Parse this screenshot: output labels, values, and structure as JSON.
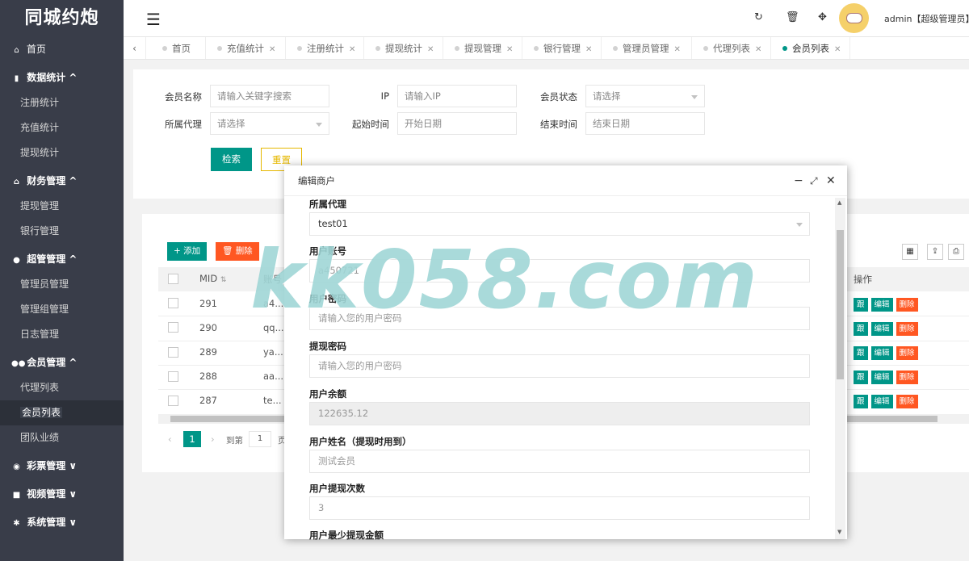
{
  "app": {
    "title": "同城约炮"
  },
  "sidebar": {
    "home": "首页",
    "groups": [
      {
        "label": "数据统计 ^",
        "icon": "bar-chart-icon",
        "items": [
          "注册统计",
          "充值统计",
          "提现统计"
        ]
      },
      {
        "label": "财务管理 ^",
        "icon": "bank-icon",
        "items": [
          "提现管理",
          "银行管理"
        ]
      },
      {
        "label": "超管管理 ^",
        "icon": "user-icon",
        "items": [
          "管理员管理",
          "管理组管理",
          "日志管理"
        ]
      },
      {
        "label": "会员管理 ^",
        "icon": "users-icon",
        "items": [
          "代理列表",
          "会员列表",
          "团队业绩"
        ]
      }
    ],
    "collapsed": [
      "彩票管理 ∨",
      "视频管理 ∨",
      "系统管理 ∨"
    ],
    "active_item": "会员列表"
  },
  "header": {
    "user": "admin【超级管理员】"
  },
  "tabs": [
    {
      "label": "首页",
      "closable": false
    },
    {
      "label": "充值统计",
      "closable": true
    },
    {
      "label": "注册统计",
      "closable": true
    },
    {
      "label": "提现统计",
      "closable": true
    },
    {
      "label": "提现管理",
      "closable": true
    },
    {
      "label": "银行管理",
      "closable": true
    },
    {
      "label": "管理员管理",
      "closable": true
    },
    {
      "label": "代理列表",
      "closable": true
    },
    {
      "label": "会员列表",
      "closable": true,
      "active": true
    }
  ],
  "search": {
    "member_name_label": "会员名称",
    "member_name_ph": "请输入关键字搜索",
    "ip_label": "IP",
    "ip_ph": "请输入IP",
    "status_label": "会员状态",
    "status_value": "请选择",
    "agent_label": "所属代理",
    "agent_value": "请选择",
    "start_label": "起始时间",
    "start_ph": "开始日期",
    "end_label": "结束时间",
    "end_ph": "结束日期",
    "search_btn": "检索",
    "reset_btn": "重置"
  },
  "table": {
    "add_btn": "+ 添加",
    "delete_btn": "删除",
    "col_mid": "MID",
    "col_account": "账号",
    "col_ops": "操作",
    "rows": [
      {
        "mid": "291",
        "account": "a4..."
      },
      {
        "mid": "290",
        "account": "qq..."
      },
      {
        "mid": "289",
        "account": "ya..."
      },
      {
        "mid": "288",
        "account": "aa..."
      },
      {
        "mid": "287",
        "account": "te..."
      }
    ],
    "op_labels": [
      "跟",
      "编辑",
      "删除"
    ],
    "pager": {
      "page": "1",
      "goto_label": "到第",
      "goto_value": "1",
      "page_unit": "页"
    }
  },
  "modal": {
    "title": "编辑商户",
    "fields": [
      {
        "label": "所属代理",
        "value": "test01",
        "type": "select"
      },
      {
        "label": "用户账号",
        "value": "a450721",
        "type": "text"
      },
      {
        "label": "用户密码",
        "value": "请输入您的用户密码",
        "type": "placeholder"
      },
      {
        "label": "提现密码",
        "value": "请输入您的用户密码",
        "type": "placeholder"
      },
      {
        "label": "用户余额",
        "value": "122635.12",
        "type": "disabled"
      },
      {
        "label": "用户姓名（提现时用到）",
        "value": "测试会员",
        "type": "placeholder"
      },
      {
        "label": "用户提现次数",
        "value": "3",
        "type": "placeholder"
      },
      {
        "label": "用户最少提现金额",
        "value": "",
        "type": "label-only"
      }
    ]
  },
  "watermark": "kk058.com"
}
